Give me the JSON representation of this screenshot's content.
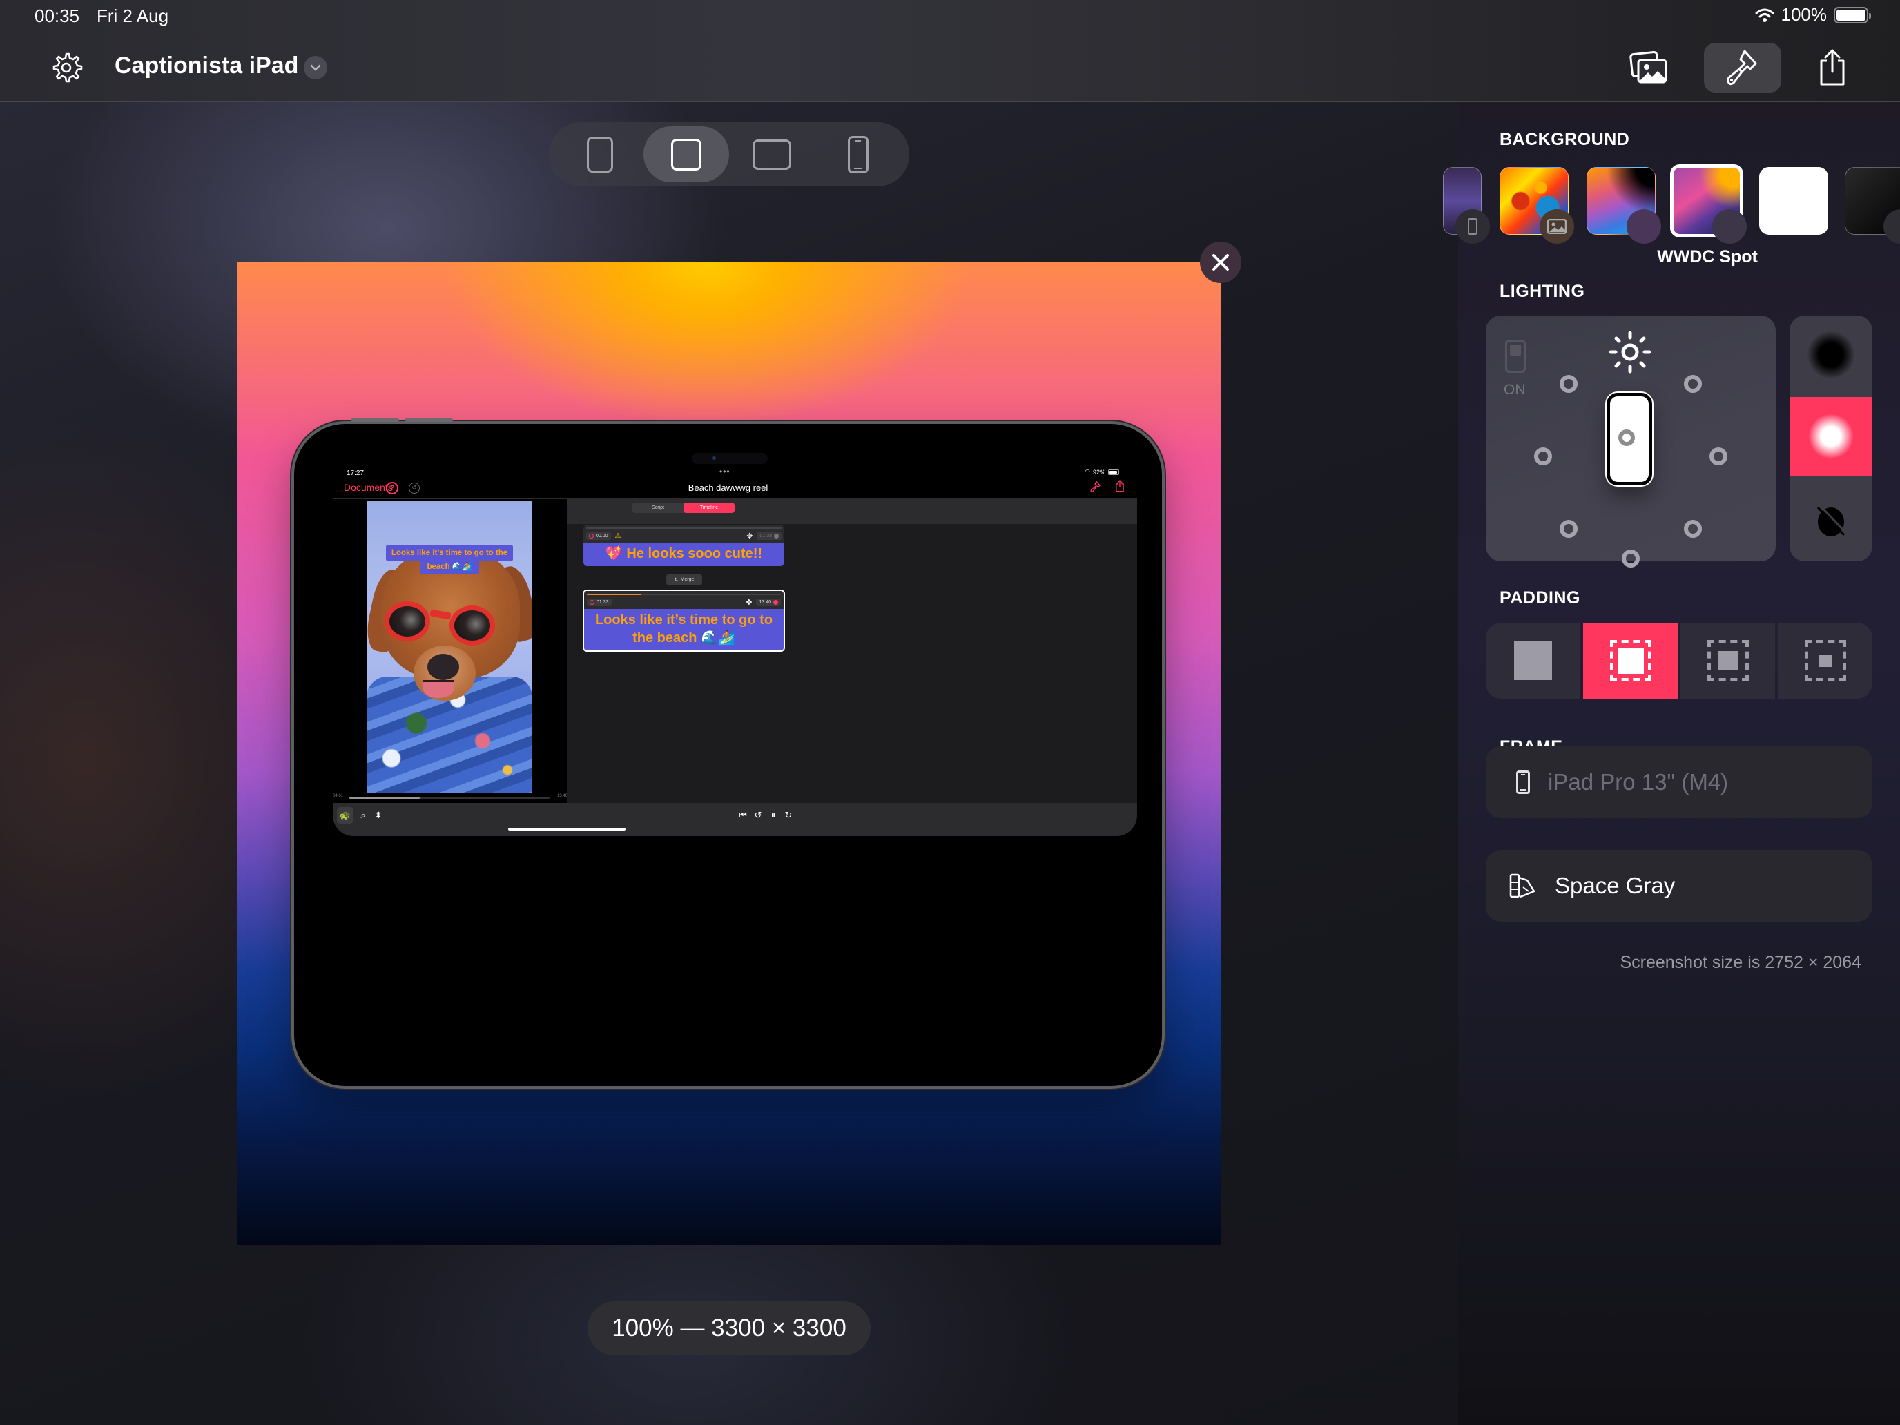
{
  "status_bar": {
    "time": "00:35",
    "date": "Fri 2 Aug",
    "battery_percent": "100%",
    "wifi_icon": "wifi-icon",
    "battery_level": 1.0
  },
  "title_bar": {
    "app_title": "Captionista iPad",
    "settings_icon": "gear-icon",
    "title_menu_icon": "chevron-down-icon",
    "toolbar": [
      {
        "name": "background-photos",
        "icon": "photo-stack-icon",
        "active": false
      },
      {
        "name": "style",
        "icon": "paintbrush-icon",
        "active": true
      },
      {
        "name": "share",
        "icon": "share-icon",
        "active": false
      }
    ]
  },
  "aspect_selector": {
    "options": [
      {
        "name": "portrait-tall",
        "icon": "portrait-rect-icon",
        "selected": false
      },
      {
        "name": "square-ish",
        "icon": "portrait-rect-icon",
        "selected": true
      },
      {
        "name": "landscape",
        "icon": "landscape-rect-icon",
        "selected": false
      },
      {
        "name": "phone",
        "icon": "iphone-icon",
        "selected": false
      }
    ]
  },
  "preview": {
    "close_icon": "close-icon",
    "zoom_label": "100% — 3300 × 3300",
    "device_screen": {
      "status_time": "17:27",
      "status_right": "92%",
      "documents_link": "Documents",
      "help_icon": "help-circle-icon",
      "undo_icon": "undo-icon",
      "doc_title": "Beach dawwwg reel",
      "brush_icon": "paintbrush-icon",
      "share_icon": "share-icon",
      "video_caption_line1": "Looks like it’s time to go to the",
      "video_caption_line2": "beach 🌊🏄",
      "scrub_start": "04.61",
      "scrub_end": "13.40",
      "scrub_progress": 0.35,
      "segments": [
        {
          "label": "Script",
          "selected": false
        },
        {
          "label": "Timeline",
          "selected": true
        }
      ],
      "captions": [
        {
          "start": "00.00",
          "end": "01.33",
          "warning": true,
          "text": "💖 He looks sooo cute!!",
          "selected": false,
          "progress": 0
        },
        {
          "start": "01.33",
          "end": "13.40",
          "warning": false,
          "text": "Looks like it’s time to go to the beach 🌊🏄",
          "selected": true,
          "progress": 0.28
        }
      ],
      "merge_label": "Merge",
      "bottom_tools": [
        "turtle-icon",
        "search-icon",
        "resize-icon"
      ],
      "playback_controls": [
        "skip-back-icon",
        "rewind-icon",
        "pause-icon",
        "forward-icon"
      ]
    }
  },
  "sidebar": {
    "background": {
      "label": "BACKGROUND",
      "selected_name": "WWDC Spot",
      "thumbnails": [
        {
          "name": "partial-purple",
          "badge": "iphone-icon"
        },
        {
          "name": "oil-bubbles",
          "badge": "photo-icon"
        },
        {
          "name": "sunset-gradient",
          "badge": "apple-logo-icon"
        },
        {
          "name": "WWDC Spot",
          "badge": "apple-logo-icon",
          "selected": true
        },
        {
          "name": "white",
          "badge": ""
        },
        {
          "name": "black",
          "badge": "loading-icon"
        }
      ]
    },
    "lighting": {
      "label": "LIGHTING",
      "toggle_label": "ON",
      "toggle_on": false,
      "light_icon": "sun-icon",
      "intensity_options": [
        {
          "name": "shadow",
          "selected": false
        },
        {
          "name": "glow",
          "selected": true
        },
        {
          "name": "none",
          "icon": "no-light-icon",
          "selected": false
        }
      ]
    },
    "padding": {
      "label": "PADDING",
      "options": [
        {
          "name": "none",
          "selected": false
        },
        {
          "name": "small",
          "selected": true
        },
        {
          "name": "medium",
          "selected": false
        },
        {
          "name": "large",
          "selected": false
        }
      ]
    },
    "frame": {
      "label": "FRAME",
      "device": "iPad Pro 13\" (M4)",
      "device_icon": "ipad-icon",
      "color": "Space Gray",
      "color_icon": "swatch-icon"
    },
    "screenshot_size": "Screenshot size is 2752 × 2064"
  },
  "colors": {
    "accent": "#ff375f",
    "caption_bg": "#5856d6",
    "caption_text": "#ff9f0a"
  }
}
